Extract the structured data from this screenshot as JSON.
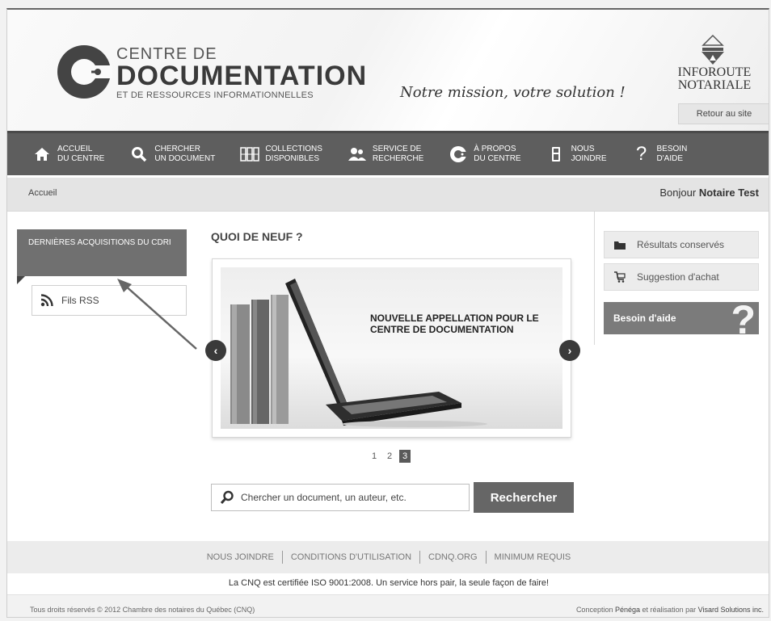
{
  "header": {
    "logo_line1": "CENTRE DE",
    "logo_line2": "DOCUMENTATION",
    "logo_line3": "ET DE RESSOURCES INFORMATIONNELLES",
    "slogan": "Notre mission, votre solution !",
    "partner_line1": "INFOROUTE",
    "partner_line2": "NOTARIALE",
    "back_link": "Retour au site"
  },
  "nav": {
    "items": [
      {
        "line1": "ACCUEIL",
        "line2": "DU CENTRE",
        "icon": "home-icon"
      },
      {
        "line1": "CHERCHER",
        "line2": "UN DOCUMENT",
        "icon": "search-icon"
      },
      {
        "line1": "COLLECTIONS",
        "line2": "DISPONIBLES",
        "icon": "books-icon"
      },
      {
        "line1": "SERVICE DE",
        "line2": "RECHERCHE",
        "icon": "people-icon"
      },
      {
        "line1": "À PROPOS",
        "line2": "DU CENTRE",
        "icon": "c-logo-icon"
      },
      {
        "line1": "NOUS",
        "line2": "JOINDRE",
        "icon": "phone-icon"
      },
      {
        "line1": "BESOIN",
        "line2": "D'AIDE",
        "icon": "question-icon"
      }
    ]
  },
  "breadcrumb": {
    "home": "Accueil",
    "greeting_prefix": "Bonjour",
    "user_name": "Notaire Test"
  },
  "left": {
    "heading": "DERNIÈRES ACQUISITIONS DU CDRI",
    "rss_label": "Fils RSS"
  },
  "main": {
    "title": "QUOI DE NEUF ?",
    "slide_text": "NOUVELLE APPELLATION POUR LE CENTRE DE DOCUMENTATION",
    "prev": "‹",
    "next": "›",
    "pages": [
      "1",
      "2",
      "3"
    ],
    "active_page": "3",
    "search_placeholder": "Chercher un document, un auteur, etc.",
    "search_button": "Rechercher"
  },
  "right": {
    "saved_results": "Résultats conservés",
    "purchase_suggestion": "Suggestion d'achat",
    "help": "Besoin d'aide",
    "help_mark": "?"
  },
  "footer": {
    "links": [
      "NOUS JOINDRE",
      "CONDITIONS D'UTILISATION",
      "CDNQ.ORG",
      "MINIMUM REQUIS"
    ],
    "certification": "La CNQ est certifiée ISO 9001:2008. Un service hors pair, la seule façon de faire!",
    "copyright": "Tous droits réservés © 2012 Chambre des notaires du Québec (CNQ)",
    "credit_prefix": "Conception",
    "credit_design": "Pénéga",
    "credit_middle": "et réalisation par",
    "credit_dev": "Visard Solutions inc."
  }
}
